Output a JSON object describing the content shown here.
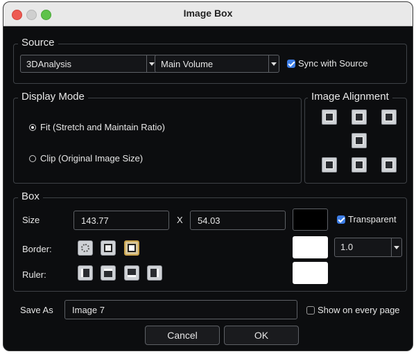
{
  "window": {
    "title": "Image Box"
  },
  "source": {
    "legend": "Source",
    "dropdown1": "3DAnalysis",
    "dropdown2": "Main Volume",
    "sync_label": "Sync with Source",
    "sync_checked": true
  },
  "display_mode": {
    "legend": "Display Mode",
    "options": [
      {
        "label": "Fit (Stretch and Maintain Ratio)",
        "selected": true
      },
      {
        "label": "Clip (Original Image Size)",
        "selected": false
      }
    ]
  },
  "alignment": {
    "legend": "Image Alignment",
    "buttons": [
      "top-left",
      "top-center",
      "top-right",
      "center",
      "bottom-left",
      "bottom-center",
      "bottom-right"
    ]
  },
  "box": {
    "legend": "Box",
    "size_label": "Size",
    "width": "143.77",
    "x_label": "X",
    "height": "54.03",
    "fill_color": "#000000",
    "transparent_label": "Transparent",
    "transparent_checked": true,
    "border_label": "Border:",
    "border_color": "#ffffff",
    "border_width": "1.0",
    "ruler_label": "Ruler:",
    "ruler_color": "#ffffff"
  },
  "save": {
    "label": "Save As",
    "value": "Image 7",
    "show_every_page_label": "Show on every page",
    "show_every_page_checked": false
  },
  "buttons": {
    "cancel": "Cancel",
    "ok": "OK"
  },
  "colors": {
    "accent": "#3c7de6",
    "background": "#0c0d0f",
    "selected_border": "#c9a24a"
  }
}
